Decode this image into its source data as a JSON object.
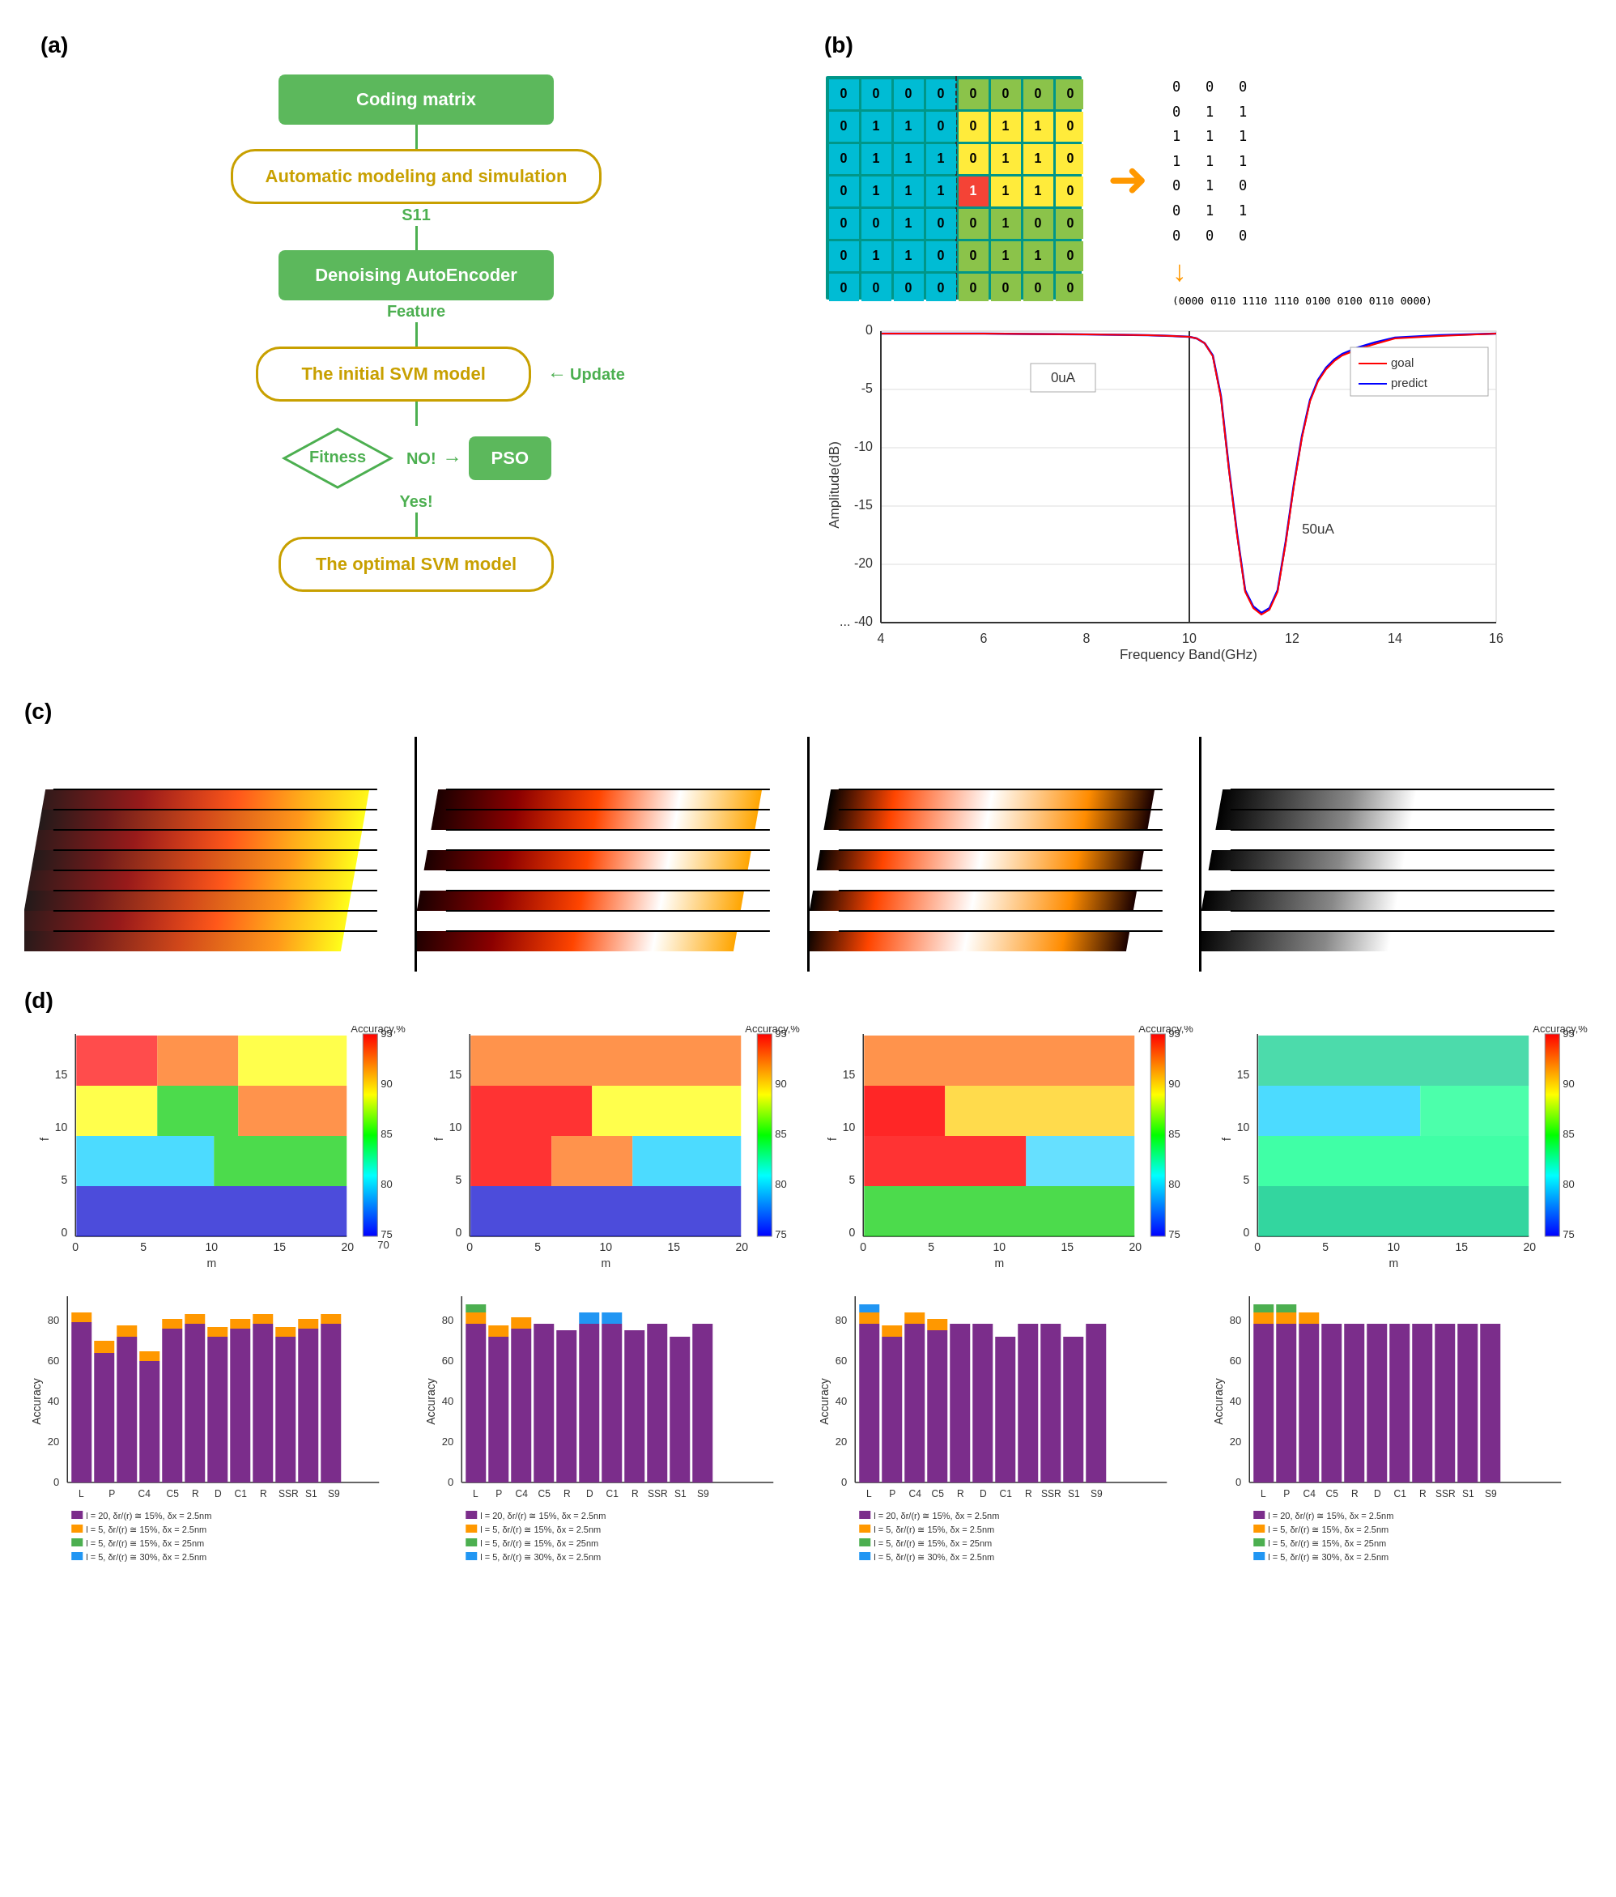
{
  "panels": {
    "a_label": "(a)",
    "b_label": "(b)",
    "c_label": "(c)",
    "d_label": "(d)"
  },
  "flowchart": {
    "coding_matrix": "Coding matrix",
    "auto_modeling": "Automatic modeling and simulation",
    "s11_label": "S11",
    "denoising": "Denoising AutoEncoder",
    "feature_label": "Feature",
    "initial_svm": "The initial SVM model",
    "update_label": "Update",
    "fitness_label": "Fitness",
    "no_label": "NO!",
    "yes_label": "Yes!",
    "pso_label": "PSO",
    "optimal_svm": "The optimal SVM model"
  },
  "matrix": {
    "left_grid": [
      [
        0,
        0,
        0,
        0,
        0,
        0,
        0,
        0
      ],
      [
        0,
        1,
        1,
        0,
        0,
        1,
        1,
        0
      ],
      [
        0,
        1,
        1,
        1,
        0,
        1,
        1,
        0
      ],
      [
        0,
        1,
        1,
        1,
        1,
        1,
        1,
        0
      ],
      [
        0,
        0,
        1,
        0,
        0,
        1,
        0,
        0
      ],
      [
        0,
        1,
        1,
        0,
        0,
        1,
        1,
        0
      ],
      [
        0,
        0,
        0,
        0,
        0,
        0,
        0,
        0
      ]
    ],
    "binary_rows": [
      "0  0  0",
      "0  1  1",
      "1  1  1",
      "1  1  1",
      "0  1  0",
      "0  1  1",
      "0  0  0"
    ],
    "binary_string": "(0000 0110 1110 1110 0100 0100 0110 0000)"
  },
  "chart": {
    "x_label": "Frequency Band(GHz)",
    "y_label": "Amplitude(dB)",
    "legend_goal": "goal",
    "legend_predict": "predict",
    "label_0uA": "0uA",
    "label_50uA": "50uA",
    "x_min": 4,
    "x_max": 16,
    "y_min": -40,
    "y_max": 0
  },
  "bar_charts": {
    "legend": [
      "l = 20, δr/(r) ≅ 15%, δx = 2.5nm",
      "l = 5, δr/(r) ≅ 15%, δx = 2.5nm",
      "l = 5, δr/(r) ≅ 15%, δx = 25nm",
      "l = 5, δr/(r) ≅ 30%, δx = 2.5nm"
    ],
    "x_labels": [
      "L",
      "P",
      "C4",
      "C5",
      "R",
      "D",
      "C1",
      "R",
      "SSR",
      "S1",
      "S9"
    ]
  },
  "scatter_plots": {
    "x_label": "m",
    "y_label": "f",
    "colorbar_label": "Accuracy,%",
    "x_max": 20,
    "y_max": 15,
    "color_min": 70,
    "color_max": 95
  }
}
